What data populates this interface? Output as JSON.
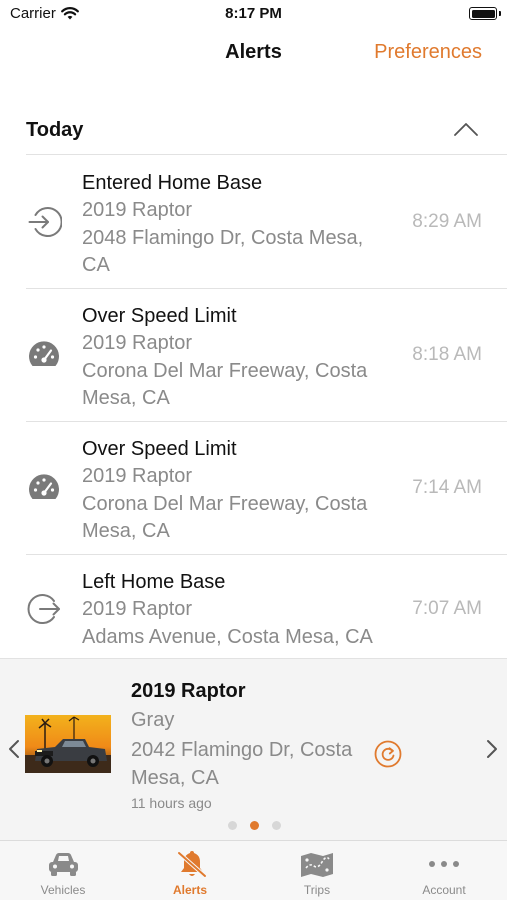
{
  "status_bar": {
    "carrier": "Carrier",
    "time": "8:17 PM"
  },
  "nav": {
    "title": "Alerts",
    "preferences_label": "Preferences"
  },
  "section": {
    "title": "Today"
  },
  "alerts": [
    {
      "icon": "enter-icon",
      "title": "Entered Home Base",
      "vehicle": "2019 Raptor",
      "address": "2048 Flamingo Dr, Costa Mesa, CA",
      "time": "8:29 AM"
    },
    {
      "icon": "speedometer-icon",
      "title": "Over Speed Limit",
      "vehicle": "2019 Raptor",
      "address": "Corona Del Mar Freeway, Costa Mesa, CA",
      "time": "8:18 AM"
    },
    {
      "icon": "speedometer-icon",
      "title": "Over Speed Limit",
      "vehicle": "2019 Raptor",
      "address": "Corona Del Mar Freeway, Costa Mesa, CA",
      "time": "7:14 AM"
    },
    {
      "icon": "exit-icon",
      "title": "Left Home Base",
      "vehicle": "2019 Raptor",
      "address": "Adams Avenue, Costa Mesa, CA",
      "time": "7:07 AM"
    }
  ],
  "vehicle_card": {
    "name": "2019 Raptor",
    "color": "Gray",
    "address": "2042 Flamingo Dr, Costa Mesa, CA",
    "updated": "11 hours ago",
    "page_count": 3,
    "active_page": 2
  },
  "tabs": [
    {
      "label": "Vehicles",
      "icon": "car-icon",
      "active": false
    },
    {
      "label": "Alerts",
      "icon": "bell-slash-icon",
      "active": true
    },
    {
      "label": "Trips",
      "icon": "map-icon",
      "active": false
    },
    {
      "label": "Account",
      "icon": "more-icon",
      "active": false
    }
  ],
  "colors": {
    "accent": "#e07a2e",
    "secondary_text": "#8a8a8a",
    "time_text": "#b9b9b9",
    "icon": "#7a7a7a"
  }
}
